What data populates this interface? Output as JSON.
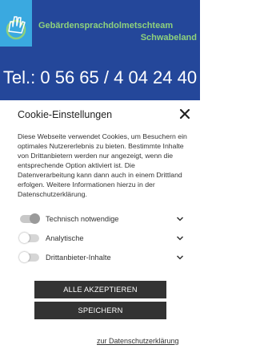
{
  "site": {
    "brand_line1": "Gebärdensprachdolmetschteam",
    "brand_line2": "Schwabeland",
    "phone": "Tel.: 0 56 65 / 4 04 24 40"
  },
  "cookie": {
    "title": "Cookie-Einstellungen",
    "description": "Diese Webseite verwendet Cookies, um Besuchern ein optimales Nutzererlebnis zu bieten. Bestimmte Inhalte von Drittanbietern werden nur angezeigt, wenn die entsprechende Option aktiviert ist. Die Datenverarbeitung kann dann auch in einem Drittland erfolgen. Weitere Informationen hierzu in der Datenschutzerklärung.",
    "options": [
      {
        "label": "Technisch notwendige",
        "enabled": true
      },
      {
        "label": "Analytische",
        "enabled": false
      },
      {
        "label": "Drittanbieter-Inhalte",
        "enabled": false
      }
    ],
    "accept_all_label": "ALLE AKZEPTIEREN",
    "save_label": "SPEICHERN",
    "privacy_link": "zur Datenschutzerklärung"
  },
  "colors": {
    "header_bg": "#24479a",
    "logo_bg": "#3aa9e0",
    "brand_text": "#8ed17c",
    "button_bg": "#333333"
  },
  "icons": [
    "hand-logo-icon",
    "close-icon",
    "chevron-down-icon"
  ]
}
